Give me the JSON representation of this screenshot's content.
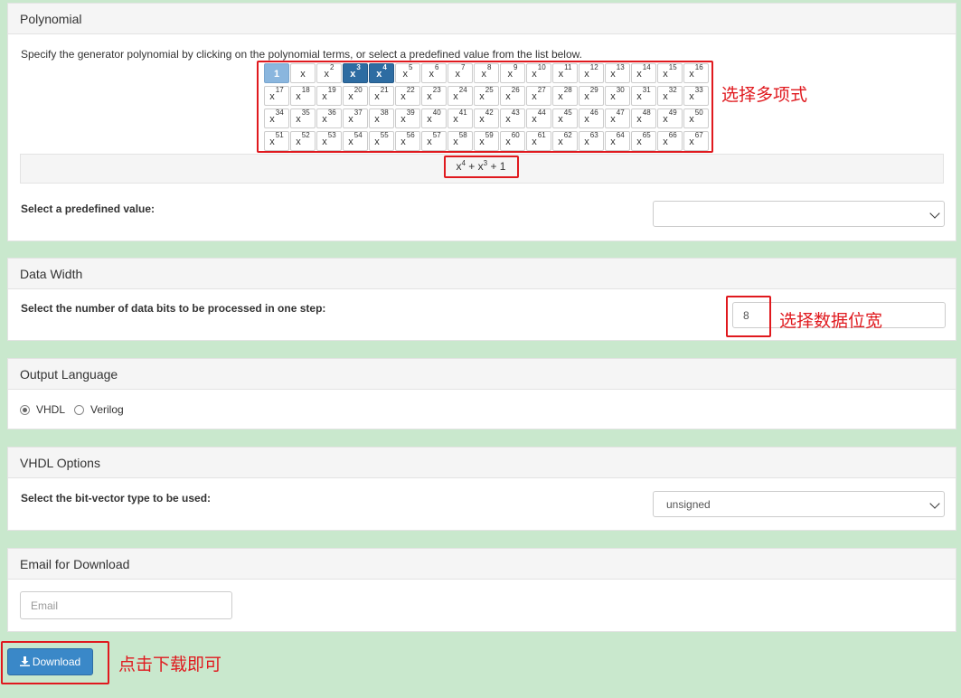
{
  "polynomial": {
    "header": "Polynomial",
    "instruction": "Specify the generator polynomial by clicking on the polynomial terms, or select a predefined value from the list below.",
    "terms": [
      {
        "base": "1",
        "exp": ""
      },
      {
        "base": "x",
        "exp": ""
      },
      {
        "base": "x",
        "exp": "2"
      },
      {
        "base": "x",
        "exp": "3"
      },
      {
        "base": "x",
        "exp": "4"
      },
      {
        "base": "x",
        "exp": "5"
      },
      {
        "base": "x",
        "exp": "6"
      },
      {
        "base": "x",
        "exp": "7"
      },
      {
        "base": "x",
        "exp": "8"
      },
      {
        "base": "x",
        "exp": "9"
      },
      {
        "base": "x",
        "exp": "10"
      },
      {
        "base": "x",
        "exp": "11"
      },
      {
        "base": "x",
        "exp": "12"
      },
      {
        "base": "x",
        "exp": "13"
      },
      {
        "base": "x",
        "exp": "14"
      },
      {
        "base": "x",
        "exp": "15"
      },
      {
        "base": "x",
        "exp": "16"
      },
      {
        "base": "x",
        "exp": "17"
      },
      {
        "base": "x",
        "exp": "18"
      },
      {
        "base": "x",
        "exp": "19"
      },
      {
        "base": "x",
        "exp": "20"
      },
      {
        "base": "x",
        "exp": "21"
      },
      {
        "base": "x",
        "exp": "22"
      },
      {
        "base": "x",
        "exp": "23"
      },
      {
        "base": "x",
        "exp": "24"
      },
      {
        "base": "x",
        "exp": "25"
      },
      {
        "base": "x",
        "exp": "26"
      },
      {
        "base": "x",
        "exp": "27"
      },
      {
        "base": "x",
        "exp": "28"
      },
      {
        "base": "x",
        "exp": "29"
      },
      {
        "base": "x",
        "exp": "30"
      },
      {
        "base": "x",
        "exp": "31"
      },
      {
        "base": "x",
        "exp": "32"
      },
      {
        "base": "x",
        "exp": "33"
      },
      {
        "base": "x",
        "exp": "34"
      },
      {
        "base": "x",
        "exp": "35"
      },
      {
        "base": "x",
        "exp": "36"
      },
      {
        "base": "x",
        "exp": "37"
      },
      {
        "base": "x",
        "exp": "38"
      },
      {
        "base": "x",
        "exp": "39"
      },
      {
        "base": "x",
        "exp": "40"
      },
      {
        "base": "x",
        "exp": "41"
      },
      {
        "base": "x",
        "exp": "42"
      },
      {
        "base": "x",
        "exp": "43"
      },
      {
        "base": "x",
        "exp": "44"
      },
      {
        "base": "x",
        "exp": "45"
      },
      {
        "base": "x",
        "exp": "46"
      },
      {
        "base": "x",
        "exp": "47"
      },
      {
        "base": "x",
        "exp": "48"
      },
      {
        "base": "x",
        "exp": "49"
      },
      {
        "base": "x",
        "exp": "50"
      },
      {
        "base": "x",
        "exp": "51"
      },
      {
        "base": "x",
        "exp": "52"
      },
      {
        "base": "x",
        "exp": "53"
      },
      {
        "base": "x",
        "exp": "54"
      },
      {
        "base": "x",
        "exp": "55"
      },
      {
        "base": "x",
        "exp": "56"
      },
      {
        "base": "x",
        "exp": "57"
      },
      {
        "base": "x",
        "exp": "58"
      },
      {
        "base": "x",
        "exp": "59"
      },
      {
        "base": "x",
        "exp": "60"
      },
      {
        "base": "x",
        "exp": "61"
      },
      {
        "base": "x",
        "exp": "62"
      },
      {
        "base": "x",
        "exp": "63"
      },
      {
        "base": "x",
        "exp": "64"
      },
      {
        "base": "x",
        "exp": "65"
      },
      {
        "base": "x",
        "exp": "66"
      },
      {
        "base": "x",
        "exp": "67"
      }
    ],
    "selected_terms": [
      "1",
      "x3",
      "x4"
    ],
    "expression": {
      "t1": "x",
      "e1": "4",
      "mid": " + x",
      "e2": "3",
      "tail": " + 1"
    },
    "predefined_label": "Select a predefined value:",
    "predefined_value": ""
  },
  "data_width": {
    "header": "Data Width",
    "label": "Select the number of data bits to be processed in one step:",
    "value": "8"
  },
  "output_language": {
    "header": "Output Language",
    "options": [
      "VHDL",
      "Verilog"
    ],
    "selected": "VHDL"
  },
  "vhdl_options": {
    "header": "VHDL Options",
    "label": "Select the bit-vector type to be used:",
    "value": "unsigned"
  },
  "email": {
    "header": "Email for Download",
    "placeholder": "Email",
    "value": ""
  },
  "download": {
    "label": "Download",
    "icon": "download-icon"
  },
  "annotations": {
    "select_terms": "选择多项式",
    "select_width": "选择数据位宽",
    "click_download": "点击下载即可",
    "color": "#e0191e"
  },
  "colors": {
    "active_term": "#2d6ca2",
    "first_term": "#8ab6de",
    "button": "#3a88c8",
    "background": "#c9e8cd"
  }
}
